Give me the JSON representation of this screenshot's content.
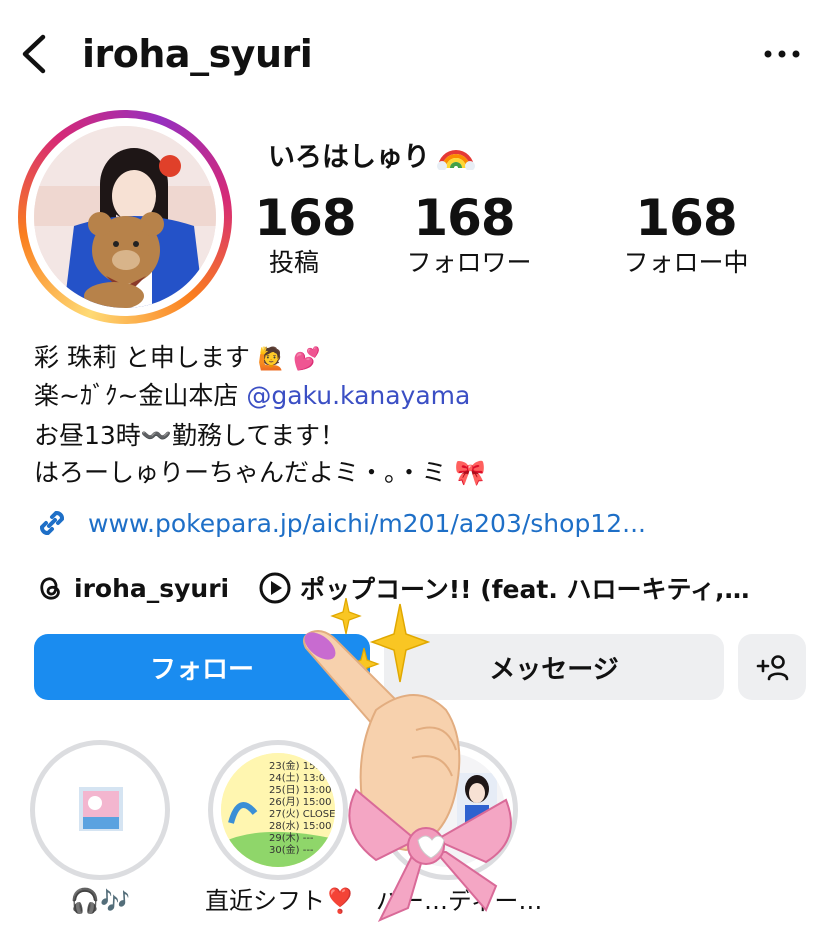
{
  "header": {
    "username": "iroha_syuri",
    "back_icon": "chevron-left-icon",
    "more_icon": "more-horizontal-icon"
  },
  "profile": {
    "display_name": "いろはしゅり",
    "display_name_emoji": "rainbow-emoji",
    "stats": {
      "posts": {
        "value": "168",
        "label": "投稿"
      },
      "followers": {
        "value": "168",
        "label": "フォロワー"
      },
      "following": {
        "value": "168",
        "label": "フォロー中"
      }
    }
  },
  "bio": {
    "line1": "彩 珠莉 と申します",
    "line2_prefix": "楽~ｶﾞｸ~金山本店 ",
    "line2_mention": "@gaku.kanayama",
    "line3": "お昼13時〰️勤務してます！",
    "line4": "はろーしゅりーちゃんだよミ・。・ミ",
    "link": "www.pokepara.jp/aichi/m201/a203/shop12..."
  },
  "threads": {
    "handle": "iroha_syuri"
  },
  "music": {
    "text": "ポップコーン!! (feat. ハローキティ,…"
  },
  "buttons": {
    "follow": "フォロー",
    "message": "メッセージ"
  },
  "highlights": [
    {
      "label": "🎧🎶"
    },
    {
      "label": "直近シフト❣️"
    },
    {
      "label": "バー…ディー…"
    }
  ],
  "shift_preview": [
    "23(金) 15:0",
    "24(土) 13:00",
    "25(日) 13:00",
    "26(月) 15:00",
    "27(火) CLOSE",
    "28(水) 15:00",
    "29(木) ---",
    "30(金) ---"
  ],
  "colors": {
    "follow_button": "#1a8cf0",
    "secondary_button": "#eeeff1",
    "link": "#1e6fc7",
    "mention": "#3b4fc4"
  }
}
